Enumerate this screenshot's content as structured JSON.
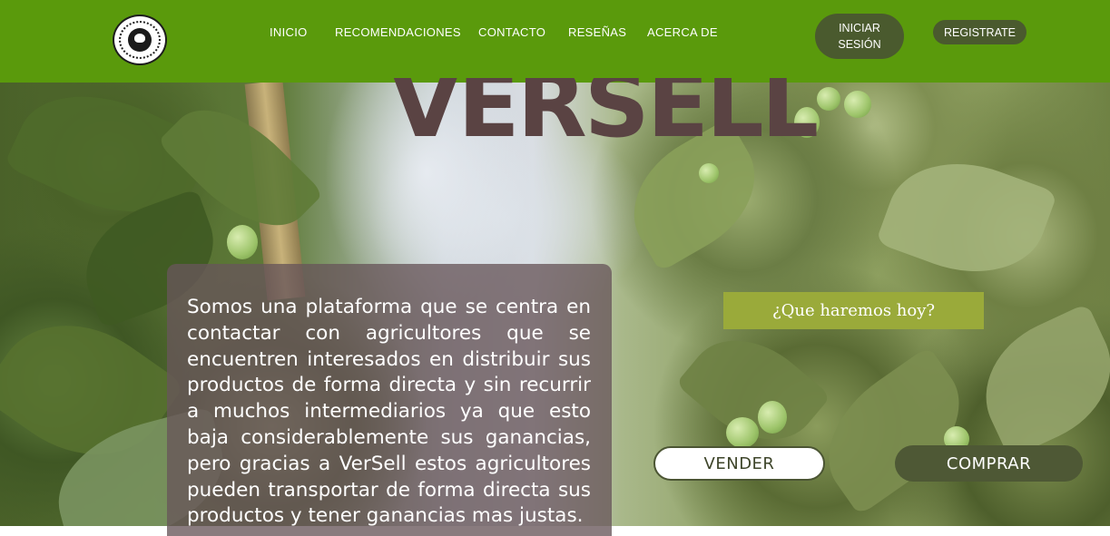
{
  "brand": {
    "name": "VERSELL"
  },
  "nav": {
    "links": [
      "INICIO",
      "RECOMENDACIONES",
      "CONTACTO",
      "RESEÑAS",
      "ACERCA DE"
    ],
    "login_label": "INICIAR SESIÓN",
    "register_label": "REGISTRATE"
  },
  "hero": {
    "description": "Somos una plataforma que se centra en contactar con agricultores que se encuentren interesados en distribuir sus productos de forma directa y sin recurrir a muchos intermediarios ya que esto baja considerablemente sus ganancias, pero gracias a VerSell estos agricultores pueden transportar de forma directa sus productos y tener ganancias mas justas.",
    "question": "¿Que haremos hoy?",
    "sell_label": "VENDER",
    "buy_label": "COMPRAR"
  },
  "colors": {
    "navbar": "#5a9a0c",
    "button_dark": "#4a5a2e",
    "question_bg": "#9aaa3a",
    "title": "#5a4343"
  },
  "icons": {
    "logo": "leaf-emblem-icon"
  }
}
